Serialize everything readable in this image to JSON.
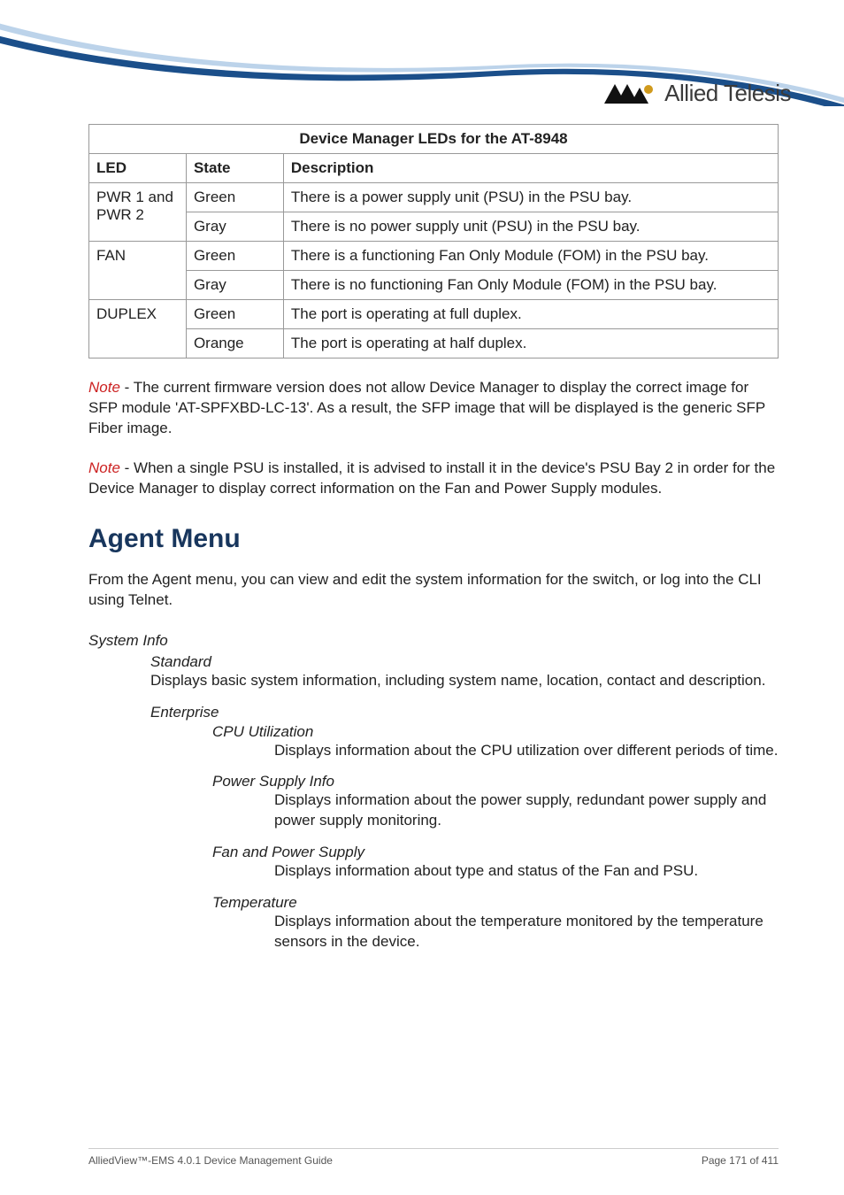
{
  "logo_text": "Allied Telesis",
  "table": {
    "caption": "Device Manager LEDs for the AT-8948",
    "head": {
      "led": "LED",
      "state": "State",
      "desc": "Description"
    },
    "rows": {
      "pwr_led": "PWR 1 and PWR 2",
      "pwr_green": {
        "state": "Green",
        "desc": "There is a power supply unit (PSU) in the PSU bay."
      },
      "pwr_gray": {
        "state": "Gray",
        "desc": "There is no power supply unit (PSU) in the PSU bay."
      },
      "fan_led": "FAN",
      "fan_green": {
        "state": "Green",
        "desc": "There is a functioning Fan Only Module (FOM) in the PSU bay."
      },
      "fan_gray": {
        "state": "Gray",
        "desc": "There is no functioning Fan Only Module (FOM) in the PSU bay."
      },
      "dup_led": "DUPLEX",
      "dup_green": {
        "state": "Green",
        "desc": "The port is operating at full duplex."
      },
      "dup_orange": {
        "state": "Orange",
        "desc": "The port is operating at half duplex."
      }
    }
  },
  "note_label": "Note",
  "note1": " - The current firmware version does not allow Device Manager to display the correct image for SFP module 'AT-SPFXBD-LC-13'. As a result, the SFP image that will be displayed is the generic SFP Fiber image.",
  "note2": " - When a single PSU is installed, it is advised to install it in the device's PSU Bay 2 in order for the Device Manager to display correct information on the Fan and Power Supply modules.",
  "agent_heading": "Agent Menu",
  "agent_intro": "From the Agent menu, you can view and edit the system information for the switch, or log into the CLI using Telnet.",
  "system_info": {
    "head": "System Info",
    "standard": {
      "head": "Standard",
      "body": "Displays basic system information, including system name, location, contact and description."
    },
    "enterprise": {
      "head": "Enterprise",
      "cpu": {
        "head": "CPU Utilization",
        "body": "Displays information about the CPU utilization over different periods of time."
      },
      "psi": {
        "head": "Power Supply Info",
        "body": "Displays information about the power supply, redundant power supply and power supply monitoring."
      },
      "fps": {
        "head": "Fan and Power Supply",
        "body": "Displays information about type and status of the Fan and PSU."
      },
      "temp": {
        "head": "Temperature",
        "body": "Displays information about the temperature monitored by the temperature sensors in the device."
      }
    }
  },
  "footer": {
    "left": "AlliedView™-EMS 4.0.1 Device Management Guide",
    "right": "Page 171 of 411"
  }
}
